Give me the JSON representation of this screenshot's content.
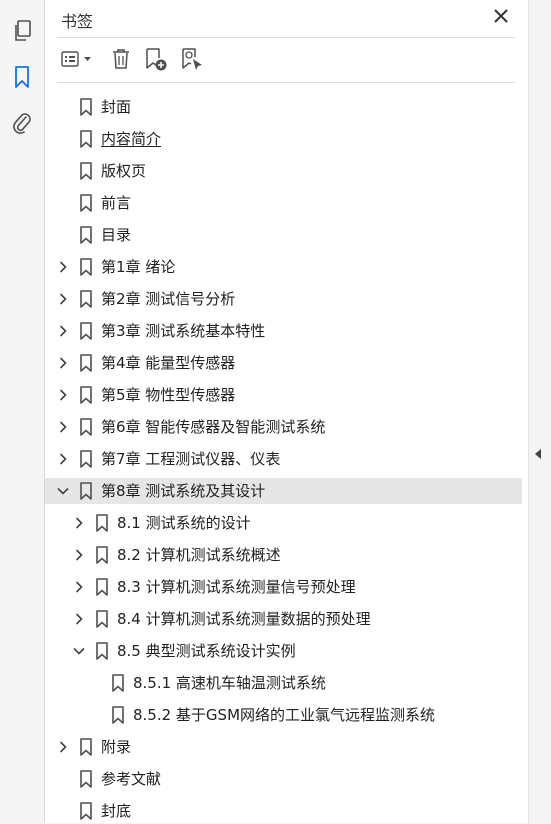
{
  "panel": {
    "title": "书签"
  },
  "bookmarks": [
    {
      "label": "封面",
      "level": 0,
      "expander": "none",
      "underline": false,
      "selected": false
    },
    {
      "label": "内容简介",
      "level": 0,
      "expander": "none",
      "underline": true,
      "selected": false
    },
    {
      "label": "版权页",
      "level": 0,
      "expander": "none",
      "underline": false,
      "selected": false
    },
    {
      "label": "前言",
      "level": 0,
      "expander": "none",
      "underline": false,
      "selected": false
    },
    {
      "label": "目录",
      "level": 0,
      "expander": "none",
      "underline": false,
      "selected": false
    },
    {
      "label": "第1章 绪论",
      "level": 0,
      "expander": "collapsed",
      "underline": false,
      "selected": false
    },
    {
      "label": "第2章 测试信号分析",
      "level": 0,
      "expander": "collapsed",
      "underline": false,
      "selected": false
    },
    {
      "label": "第3章 测试系统基本特性",
      "level": 0,
      "expander": "collapsed",
      "underline": false,
      "selected": false
    },
    {
      "label": "第4章 能量型传感器",
      "level": 0,
      "expander": "collapsed",
      "underline": false,
      "selected": false
    },
    {
      "label": "第5章 物性型传感器",
      "level": 0,
      "expander": "collapsed",
      "underline": false,
      "selected": false
    },
    {
      "label": "第6章 智能传感器及智能测试系统",
      "level": 0,
      "expander": "collapsed",
      "underline": false,
      "selected": false
    },
    {
      "label": "第7章 工程测试仪器、仪表",
      "level": 0,
      "expander": "collapsed",
      "underline": false,
      "selected": false
    },
    {
      "label": "第8章 测试系统及其设计",
      "level": 0,
      "expander": "expanded",
      "underline": false,
      "selected": true
    },
    {
      "label": "8.1 测试系统的设计",
      "level": 1,
      "expander": "collapsed",
      "underline": false,
      "selected": false
    },
    {
      "label": "8.2 计算机测试系统概述",
      "level": 1,
      "expander": "collapsed",
      "underline": false,
      "selected": false
    },
    {
      "label": "8.3 计算机测试系统测量信号预处理",
      "level": 1,
      "expander": "collapsed",
      "underline": false,
      "selected": false
    },
    {
      "label": "8.4 计算机测试系统测量数据的预处理",
      "level": 1,
      "expander": "collapsed",
      "underline": false,
      "selected": false
    },
    {
      "label": "8.5 典型测试系统设计实例",
      "level": 1,
      "expander": "expanded",
      "underline": false,
      "selected": false
    },
    {
      "label": "8.5.1 高速机车轴温测试系统",
      "level": 2,
      "expander": "none",
      "underline": false,
      "selected": false
    },
    {
      "label": "8.5.2 基于GSM网络的工业氯气远程监测系统",
      "level": 2,
      "expander": "none",
      "underline": false,
      "selected": false
    },
    {
      "label": "附录",
      "level": 0,
      "expander": "collapsed",
      "underline": false,
      "selected": false
    },
    {
      "label": "参考文献",
      "level": 0,
      "expander": "none",
      "underline": false,
      "selected": false
    },
    {
      "label": "封底",
      "level": 0,
      "expander": "none",
      "underline": false,
      "selected": false
    }
  ],
  "icons": {
    "rail": [
      "pages-icon",
      "bookmarks-icon",
      "attachments-icon"
    ],
    "toolbar": [
      "options-menu-icon",
      "delete-icon",
      "new-bookmark-icon",
      "bookmark-find-icon"
    ]
  },
  "colors": {
    "accent": "#1473e6",
    "selected_row": "#e6e6e6",
    "icon": "#505050"
  }
}
